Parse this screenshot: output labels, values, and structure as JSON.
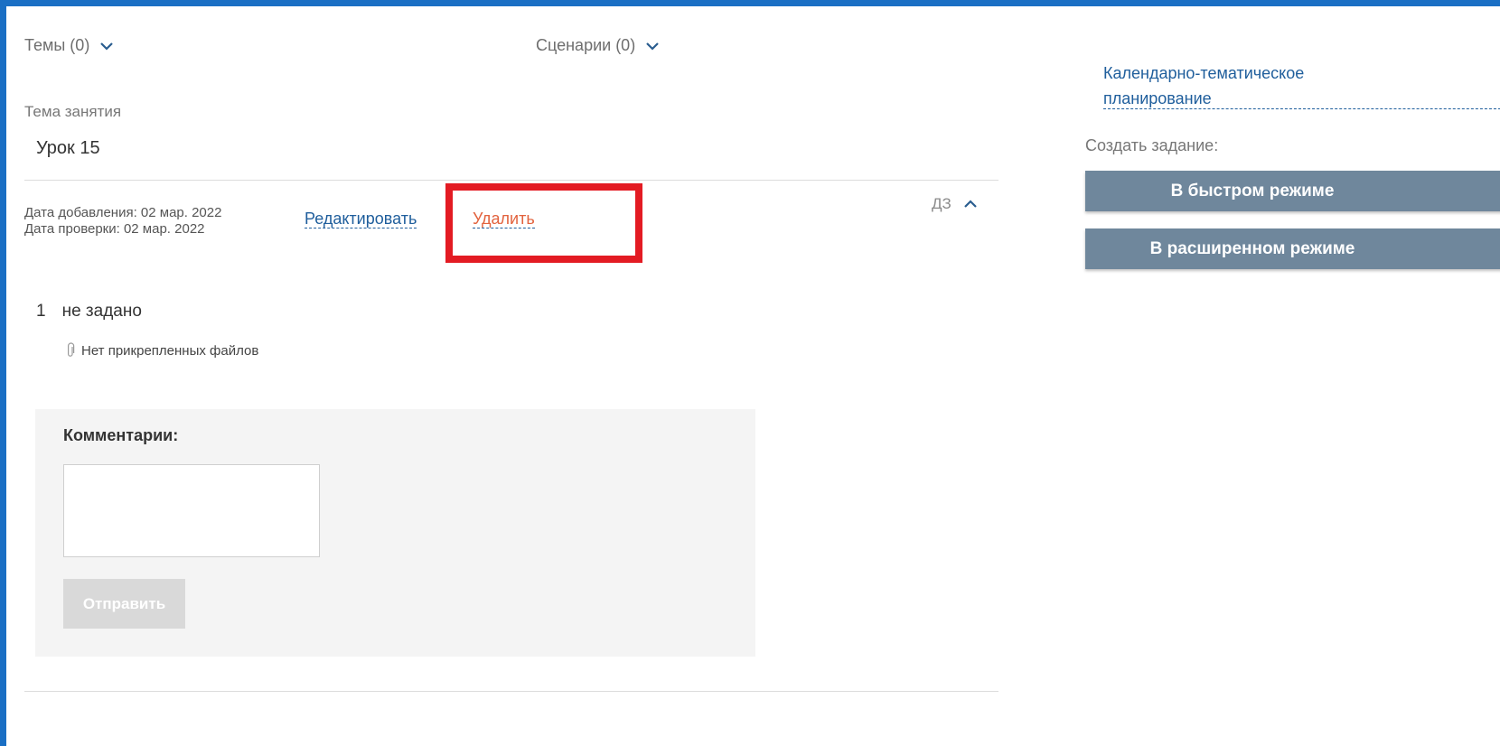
{
  "dropdowns": {
    "topics_label": "Темы (0)",
    "scenarios_label": "Сценарии (0)"
  },
  "lesson": {
    "topic_caption": "Тема занятия",
    "topic_value": "Урок 15"
  },
  "homework": {
    "date_added": "Дата добавления: 02 мар. 2022",
    "date_checked": "Дата проверки: 02 мар. 2022",
    "edit_label": "Редактировать",
    "delete_label": "Удалить",
    "section_label": "ДЗ",
    "task_number": "1",
    "task_text": "не задано",
    "attachments_text": "Нет прикрепленных файлов"
  },
  "comments": {
    "title": "Комментарии:",
    "input_value": "",
    "send_label": "Отправить"
  },
  "sidebar": {
    "planning_link": "Календарно-тематическое планирование",
    "create_task_label": "Создать задание:",
    "quick_mode_button": "В быстром режиме",
    "extended_mode_button": "В расширенном режиме"
  },
  "colors": {
    "frame": "#1a6fc4",
    "highlight": "#e31b23",
    "link": "#1f5e9c",
    "delete_link": "#e2623d",
    "side_button": "#6f879c"
  },
  "icons": {
    "dropdown": "chevron-down-icon",
    "collapse": "chevron-up-icon",
    "attachment": "paperclip-icon"
  }
}
